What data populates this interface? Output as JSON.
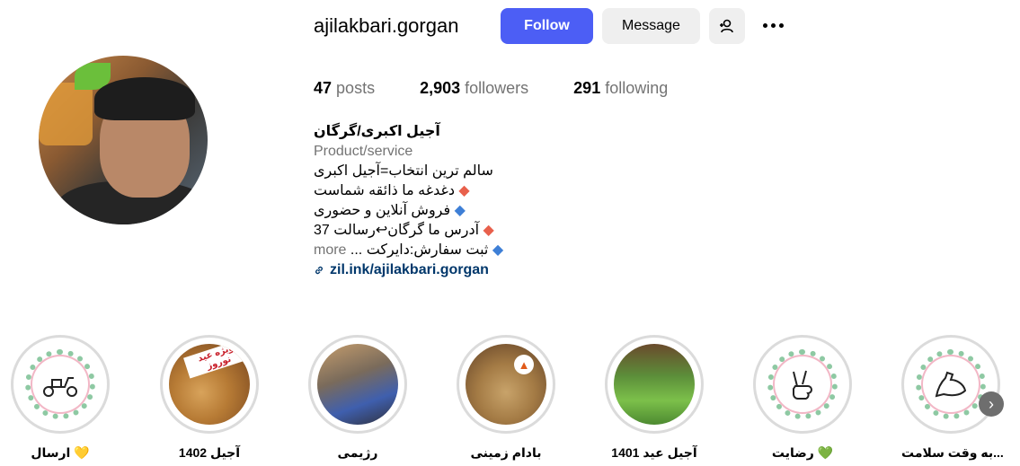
{
  "profile": {
    "username": "ajilakbari.gorgan",
    "follow_label": "Follow",
    "message_label": "Message",
    "stats": {
      "posts_num": "47",
      "posts_label": "posts",
      "followers_num": "2,903",
      "followers_label": "followers",
      "following_num": "291",
      "following_label": "following"
    },
    "bio": {
      "name": "آجیل اکبری/گرگان",
      "category": "Product/service",
      "lines": [
        "سالم ترین انتخاب=آجیل اکبری",
        "دغدغه ما ذائقه شماست",
        "فروش آنلاین و حضوری",
        "آدرس ما گرگان↩رسالت 37",
        "ثبت سفارش:دایرکت ..."
      ],
      "more": "more",
      "link": "zil.ink/ajilakbari.gorgan"
    }
  },
  "highlights": [
    {
      "label": "ارسال 💛"
    },
    {
      "label": "آجیل 1402"
    },
    {
      "label": "رژیمی"
    },
    {
      "label": "بادام زمینی"
    },
    {
      "label": "آجیل عید 1401"
    },
    {
      "label": "رضایت 💚"
    },
    {
      "label": "به وقت سلامت..."
    }
  ],
  "highlight_images": {
    "ajil_sticker": "ویژه عید نوروز",
    "icon_names": [
      "scooter-icon",
      "nuts-photo",
      "diet-bag-photo",
      "peanuts-photo",
      "boxes-photo",
      "peace-hand-icon",
      "muscle-icon"
    ]
  },
  "colors": {
    "follow_bg": "#4c5ef5",
    "link": "#00376b",
    "muted": "#737373"
  }
}
